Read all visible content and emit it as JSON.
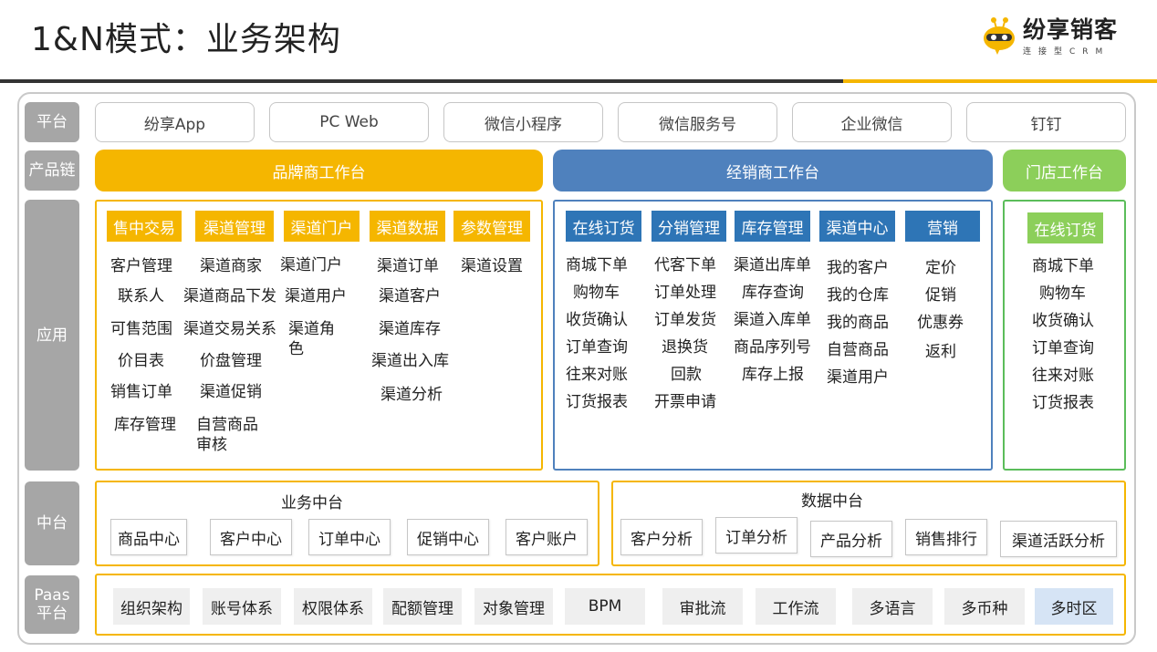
{
  "title": "1&N模式：业务架构",
  "logo": {
    "name": "纷享销客",
    "sub": "连接型CRM"
  },
  "colors": {
    "brand": "#f5b600",
    "distributor": "#4f81bd",
    "store": "#8ccf5a",
    "side": "#a6a6a6"
  },
  "rows": {
    "platform": "平台",
    "product_chain": "产品链",
    "application": "应用",
    "middle": "中台",
    "paas": "Paas平台"
  },
  "platforms": [
    "纷享App",
    "PC Web",
    "微信小程序",
    "微信服务号",
    "企业微信",
    "钉钉"
  ],
  "product_chain": {
    "brand": "品牌商工作台",
    "distributor": "经销商工作台",
    "store": "门店工作台"
  },
  "brand_app": {
    "columns": [
      {
        "header": "售中交易",
        "items": [
          "客户管理",
          "联系人",
          "可售范围",
          "价目表",
          "销售订单",
          "库存管理"
        ]
      },
      {
        "header": "渠道管理",
        "items": [
          "渠道商家",
          "渠道商品下发",
          "渠道交易关系",
          "价盘管理",
          "渠道促销",
          "自营商品审核"
        ]
      },
      {
        "header": "渠道门户",
        "items": [
          "渠道门户",
          "渠道用户",
          "渠道角色"
        ]
      },
      {
        "header": "渠道数据",
        "items": [
          "渠道订单",
          "渠道客户",
          "渠道库存",
          "渠道出入库",
          "渠道分析"
        ]
      },
      {
        "header": "参数管理",
        "items": [
          "渠道设置"
        ]
      }
    ]
  },
  "distributor_app": {
    "columns": [
      {
        "header": "在线订货",
        "items": [
          "商城下单",
          "购物车",
          "收货确认",
          "订单查询",
          "往来对账",
          "订货报表"
        ]
      },
      {
        "header": "分销管理",
        "items": [
          "代客下单",
          "订单处理",
          "订单发货",
          "退换货",
          "回款",
          "开票申请"
        ]
      },
      {
        "header": "库存管理",
        "items": [
          "渠道出库单",
          "库存查询",
          "渠道入库单",
          "商品序列号",
          "库存上报"
        ]
      },
      {
        "header": "渠道中心",
        "items": [
          "我的客户",
          "我的仓库",
          "我的商品",
          "自营商品",
          "渠道用户"
        ]
      },
      {
        "header": "营销",
        "items": [
          "定价",
          "促销",
          "优惠券",
          "返利"
        ]
      }
    ]
  },
  "store_app": {
    "header": "在线订货",
    "items": [
      "商城下单",
      "购物车",
      "收货确认",
      "订单查询",
      "往来对账",
      "订货报表"
    ]
  },
  "business_middle": {
    "title": "业务中台",
    "items": [
      "商品中心",
      "客户中心",
      "订单中心",
      "促销中心",
      "客户账户"
    ]
  },
  "data_middle": {
    "title": "数据中台",
    "items": [
      "客户分析",
      "订单分析",
      "产品分析",
      "销售排行",
      "渠道活跃分析"
    ]
  },
  "paas": [
    "组织架构",
    "账号体系",
    "权限体系",
    "配额管理",
    "对象管理",
    "BPM",
    "审批流",
    "工作流",
    "多语言",
    "多币种",
    "多时区"
  ]
}
